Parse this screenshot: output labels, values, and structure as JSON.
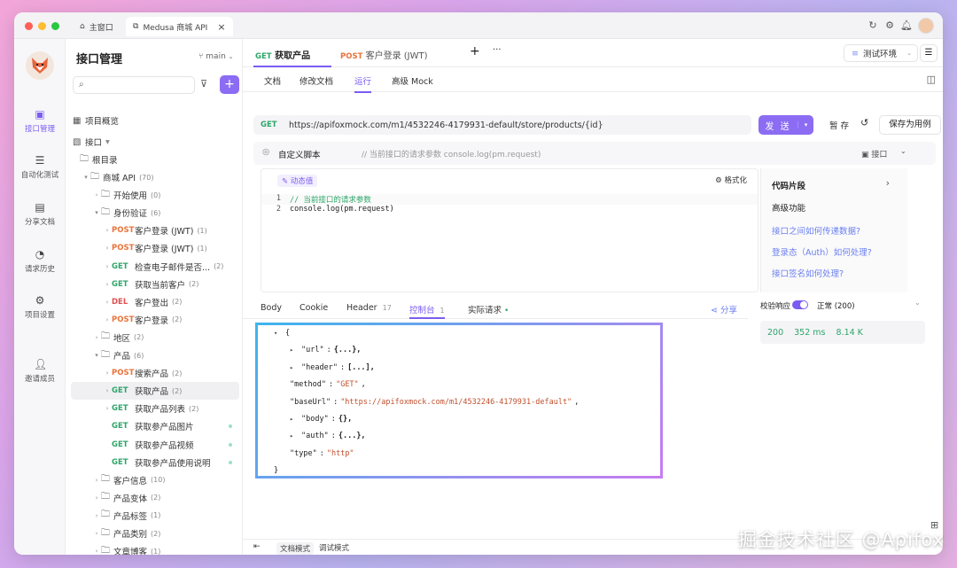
{
  "titlebar": {
    "home_tab": "主窗口",
    "active_tab": "Medusa 商城 API",
    "close": "×"
  },
  "leftnav": {
    "items": [
      {
        "label": "接口管理",
        "icon": "api-icon"
      },
      {
        "label": "自动化测试",
        "icon": "automation-icon"
      },
      {
        "label": "分享文档",
        "icon": "share-doc-icon"
      },
      {
        "label": "请求历史",
        "icon": "history-icon"
      },
      {
        "label": "项目设置",
        "icon": "settings-icon"
      },
      {
        "label": "邀请成员",
        "icon": "invite-icon"
      }
    ]
  },
  "tree": {
    "title": "接口管理",
    "branch": "main",
    "overview": "项目概览",
    "api_section": "接口",
    "root": "根目录",
    "rows": [
      {
        "type": "folder",
        "name": "商城 API",
        "count": "(70)",
        "indent": 1
      },
      {
        "type": "folder",
        "name": "开始使用",
        "count": "(0)",
        "indent": 2
      },
      {
        "type": "folder",
        "name": "身份验证",
        "count": "(6)",
        "indent": 2
      },
      {
        "type": "api",
        "method": "POST",
        "name": "客户登录 (JWT)",
        "count": "(1)",
        "indent": 3
      },
      {
        "type": "api",
        "method": "POST",
        "name": "客户登录 (JWT)",
        "count": "(1)",
        "indent": 3
      },
      {
        "type": "api",
        "method": "GET",
        "name": "检查电子邮件是否...",
        "count": "(2)",
        "indent": 3
      },
      {
        "type": "api",
        "method": "GET",
        "name": "获取当前客户",
        "count": "(2)",
        "indent": 3
      },
      {
        "type": "api",
        "method": "DEL",
        "name": "客户登出",
        "count": "(2)",
        "indent": 3
      },
      {
        "type": "api",
        "method": "POST",
        "name": "客户登录",
        "count": "(2)",
        "indent": 3
      },
      {
        "type": "folder",
        "name": "地区",
        "count": "(2)",
        "indent": 2
      },
      {
        "type": "folder",
        "name": "产品",
        "count": "(6)",
        "indent": 2
      },
      {
        "type": "api",
        "method": "POST",
        "name": "搜索产品",
        "count": "(2)",
        "indent": 3
      },
      {
        "type": "api",
        "method": "GET",
        "name": "获取产品",
        "count": "(2)",
        "indent": 3,
        "selected": true
      },
      {
        "type": "api",
        "method": "GET",
        "name": "获取产品列表",
        "count": "(2)",
        "indent": 3
      },
      {
        "type": "api",
        "method": "GET",
        "name": "获取参产品图片",
        "count": "",
        "indent": 3,
        "dot": true
      },
      {
        "type": "api",
        "method": "GET",
        "name": "获取参产品视频",
        "count": "",
        "indent": 3,
        "dot": true
      },
      {
        "type": "api",
        "method": "GET",
        "name": "获取参产品使用说明",
        "count": "",
        "indent": 3,
        "dot": true
      },
      {
        "type": "folder",
        "name": "客户信息",
        "count": "(10)",
        "indent": 2
      },
      {
        "type": "folder",
        "name": "产品变体",
        "count": "(2)",
        "indent": 2
      },
      {
        "type": "folder",
        "name": "产品标签",
        "count": "(1)",
        "indent": 2
      },
      {
        "type": "folder",
        "name": "产品类别",
        "count": "(2)",
        "indent": 2
      },
      {
        "type": "folder",
        "name": "文章博客",
        "count": "(1)",
        "indent": 2
      }
    ]
  },
  "reqtabs": {
    "tab1_method": "GET",
    "tab1_name": "获取产品",
    "tab2_method": "POST",
    "tab2_name": "客户登录 (JWT)",
    "add": "+",
    "more": "···",
    "env": "测试环境"
  },
  "subtabs": [
    "文档",
    "修改文档",
    "运行",
    "高级 Mock"
  ],
  "url": {
    "method": "GET",
    "value": "https://apifoxmock.com/m1/4532246-4179931-default/store/products/{id}",
    "send": "发 送",
    "save": "暂 存",
    "save_case": "保存为用例"
  },
  "script": {
    "label": "自定义脚本",
    "comment": "// 当前接口的请求参数 console.log(pm.request)",
    "api_label": "接口",
    "dynamic": "动态值",
    "format": "格式化",
    "lines": [
      "// 当前接口的请求参数",
      "console.log(pm.request)"
    ]
  },
  "snippets": {
    "title": "代码片段",
    "advanced": "高级功能",
    "links": [
      "接口之间如何传递数据?",
      "登录态（Auth）如何处理?",
      "接口签名如何处理?"
    ]
  },
  "bottomtabs": {
    "body": "Body",
    "cookie": "Cookie",
    "header": "Header",
    "header_count": "17",
    "console": "控制台",
    "console_count": "1",
    "actual": "实际请求",
    "share": "分享"
  },
  "console_lines": [
    {
      "kind": "open",
      "text": "{"
    },
    {
      "kind": "collapsed",
      "key": "\"url\"",
      "val": "{...},"
    },
    {
      "kind": "collapsed",
      "key": "\"header\"",
      "val": "[...],"
    },
    {
      "kind": "kv",
      "key": "\"method\"",
      "val": "\"GET\"",
      "tail": ","
    },
    {
      "kind": "kv",
      "key": "\"baseUrl\"",
      "val": "\"https://apifoxmock.com/m1/4532246-4179931-default\"",
      "tail": ","
    },
    {
      "kind": "collapsed",
      "key": "\"body\"",
      "val": "{},"
    },
    {
      "kind": "collapsed",
      "key": "\"auth\"",
      "val": "{...},"
    },
    {
      "kind": "kv",
      "key": "\"type\"",
      "val": "\"http\"",
      "tail": ""
    },
    {
      "kind": "close",
      "text": "}"
    }
  ],
  "response": {
    "validate_label": "校验响应",
    "status_text": "正常 (200)",
    "code": "200",
    "time": "352 ms",
    "size": "8.14 K"
  },
  "footer": {
    "doc_mode": "文档模式",
    "debug_mode": "调试模式"
  },
  "watermark": "掘金技术社区 @Apifox",
  "colors": {
    "accent": "#7b5cf0",
    "get": "#2fa56b",
    "post": "#e8743b",
    "del": "#e25050"
  }
}
